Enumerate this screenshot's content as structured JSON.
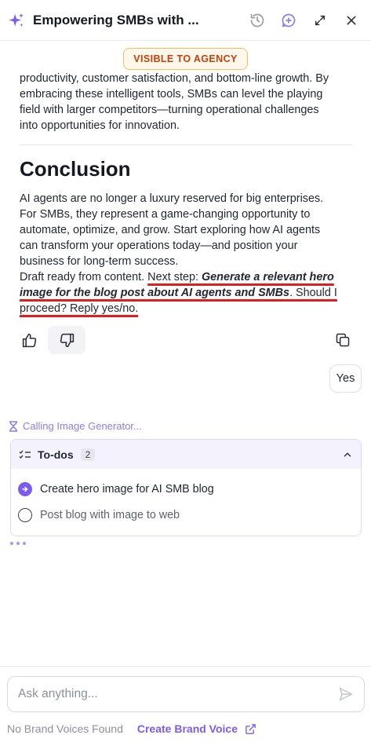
{
  "header": {
    "title": "Empowering SMBs with ...",
    "logo_icon": "sparkle-icon",
    "buttons": [
      "history-icon",
      "new-chat-icon",
      "expand-icon",
      "close-icon"
    ]
  },
  "badge": "VISIBLE TO AGENCY",
  "article": {
    "intro_lines": [
      "productivity, customer satisfaction, and bottom-line growth. By",
      "embracing these intelligent tools, SMBs can level the playing",
      "field with larger competitors—turning operational challenges",
      "into opportunities for innovation."
    ],
    "heading": "Conclusion",
    "conclusion": "AI agents are no longer a luxury reserved for big enterprises. For SMBs, they represent a game-changing opportunity to automate, optimize, and grow. Start exploring how AI agents can transform your operations today—and position your business for long-term success.",
    "draft_lead": "Draft ready from content. ",
    "next_step_label": "Next step: ",
    "next_step_bold": "Generate a relevant hero image for the blog post about AI agents and SMBs",
    "next_step_tail": ". Should I proceed? Reply yes/no."
  },
  "feedback": {
    "like_icon": "thumbs-up-icon",
    "dislike_icon": "thumbs-down-icon",
    "copy_icon": "copy-icon"
  },
  "reply": "Yes",
  "status": "Calling Image Generator...",
  "todos": {
    "title": "To-dos",
    "count": "2",
    "items": [
      {
        "label": "Create hero image for AI SMB blog",
        "state": "in-progress"
      },
      {
        "label": "Post blog with image to web",
        "state": "pending"
      }
    ]
  },
  "input": {
    "placeholder": "Ask anything..."
  },
  "footer": {
    "no_brand": "No Brand Voices Found",
    "create_brand": "Create Brand Voice"
  },
  "colors": {
    "accent": "#7c5cf0",
    "underline": "#e11d1d",
    "badge_text": "#c2410c",
    "badge_border": "#f1bf5a"
  }
}
